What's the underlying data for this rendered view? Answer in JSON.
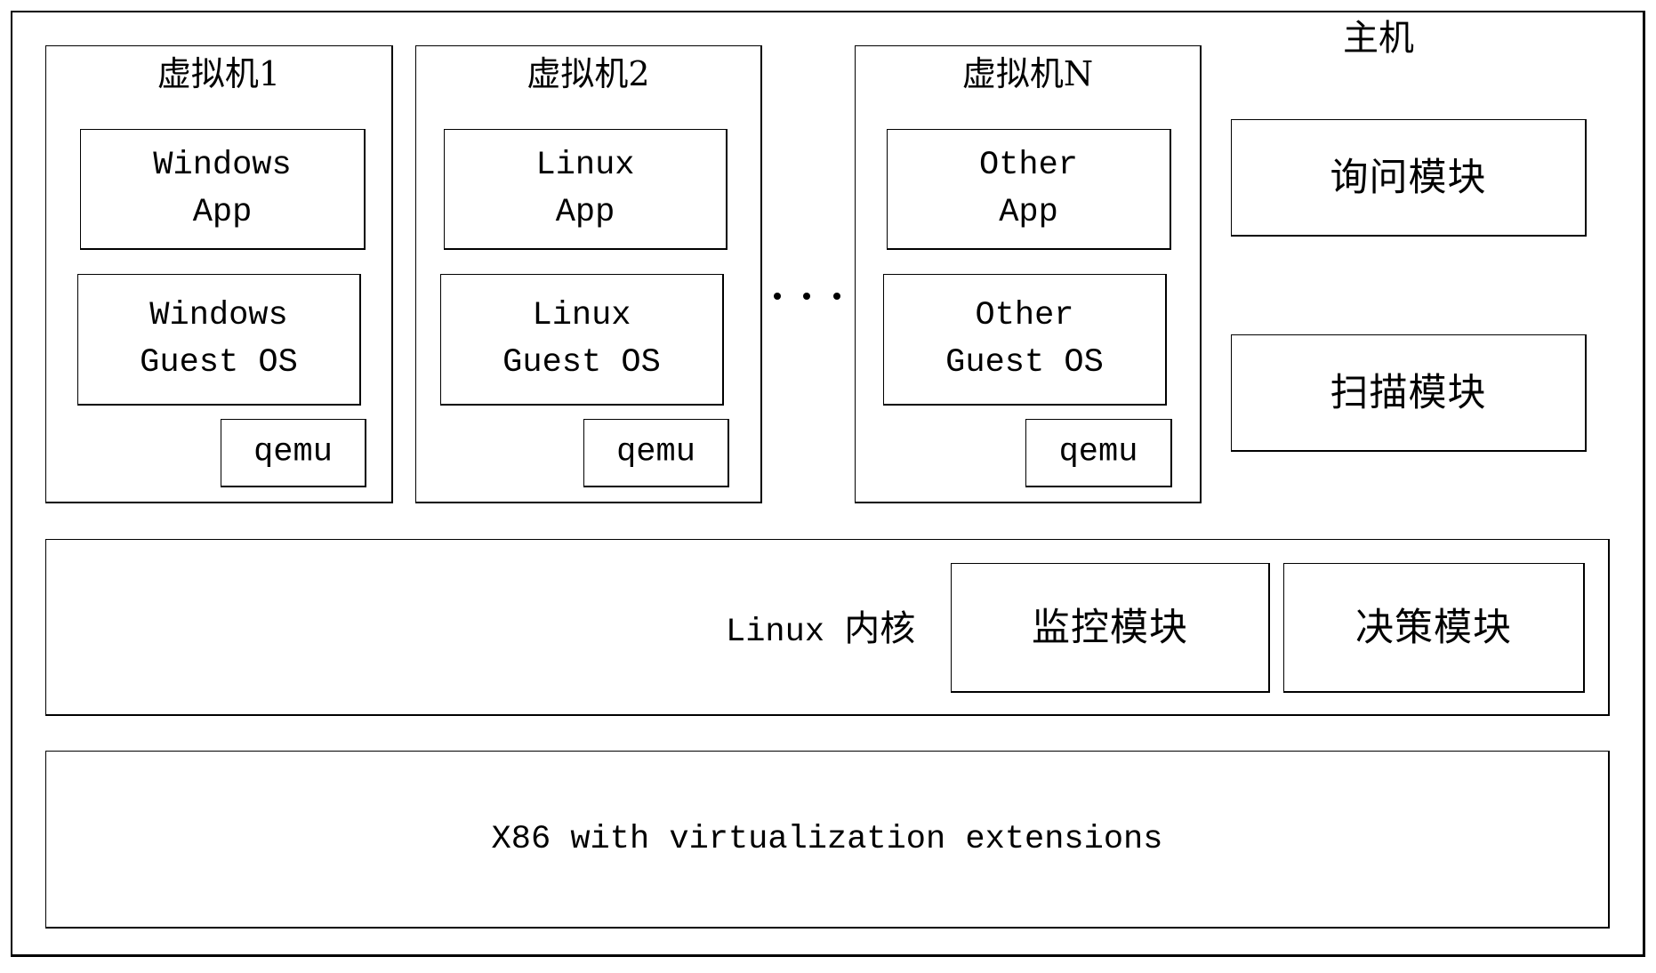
{
  "host": {
    "label": "主机",
    "inquiry_module": "询问模块",
    "scan_module": "扫描模块"
  },
  "vms": [
    {
      "title": "虚拟机1",
      "app": "Windows\nApp",
      "guest_os": "Windows\nGuest OS",
      "emulator": "qemu"
    },
    {
      "title": "虚拟机2",
      "app": "Linux\nApp",
      "guest_os": "Linux\nGuest OS",
      "emulator": "qemu"
    },
    {
      "title": "虚拟机N",
      "app": "Other\nApp",
      "guest_os": "Other\nGuest OS",
      "emulator": "qemu"
    }
  ],
  "ellipsis": "···",
  "kernel": {
    "label": "Linux 内核",
    "monitor_module": "监控模块",
    "decision_module": "决策模块"
  },
  "hardware": {
    "label": "X86 with virtualization extensions"
  }
}
